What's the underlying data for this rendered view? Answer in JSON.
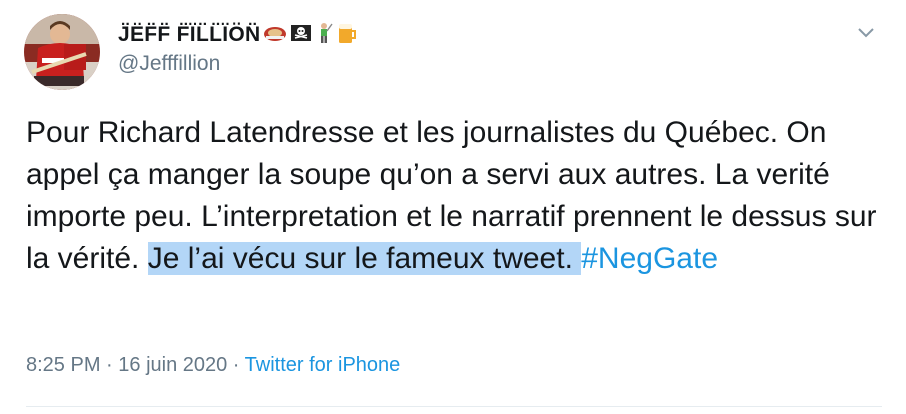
{
  "user": {
    "display_name": "J̈ËF̈F̈ F̈ÏL̈L̈ÏÖN̈",
    "handle": "@Jefffillion",
    "name_emojis": [
      "hockey-glove-emoji",
      "skull-flag-emoji",
      "golfer-emoji",
      "beer-emoji"
    ]
  },
  "tweet": {
    "text_plain": "Pour Richard Latendresse et les journalistes du Québec. On appel ça manger la soupe qu’on a servi aux autres. La verité importe peu. L’interpretation et le narratif prennent le dessus sur la vérité. ",
    "text_highlighted": "Je l’ai vécu sur le fameux tweet. ",
    "hashtag": "#NegGate"
  },
  "meta": {
    "time": "8:25 PM",
    "sep1": " · ",
    "date": "16 juin 2020",
    "sep2": " · ",
    "source": "Twitter for iPhone"
  },
  "colors": {
    "link": "#1b95e0",
    "highlight": "#b3d6f7",
    "muted": "#657786"
  }
}
